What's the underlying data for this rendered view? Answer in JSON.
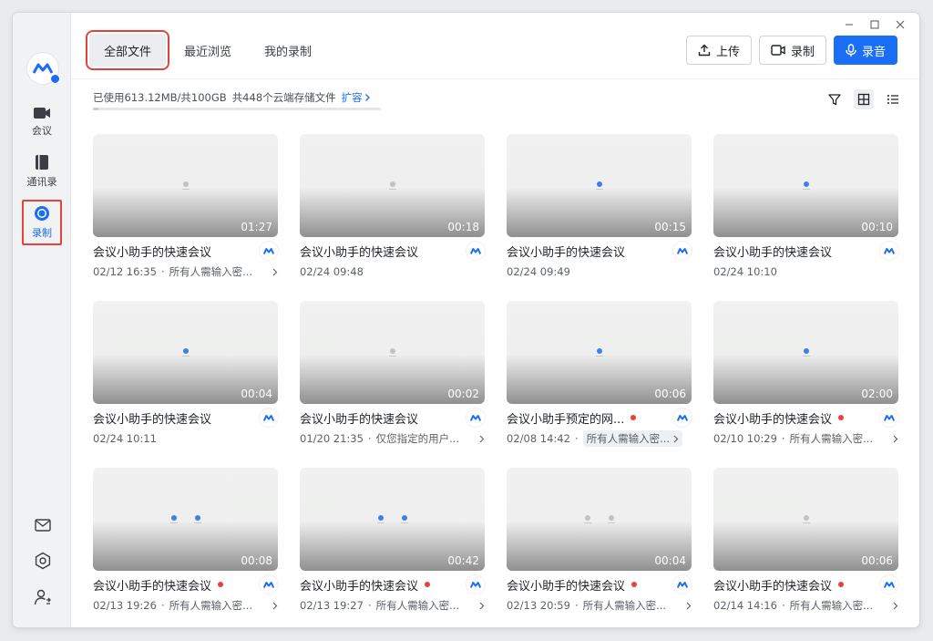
{
  "window": {
    "controls": [
      "minimize",
      "maximize",
      "close"
    ]
  },
  "sidebar": {
    "logo_text": "腾讯会议",
    "items": [
      {
        "label": "会议",
        "icon": "video-icon"
      },
      {
        "label": "通讯录",
        "icon": "contacts-icon"
      },
      {
        "label": "录制",
        "icon": "record-icon",
        "active": true
      }
    ],
    "bottom_icons": [
      "mail-icon",
      "settings-icon",
      "user-switch-icon"
    ]
  },
  "tabs": [
    {
      "label": "全部文件",
      "active": true
    },
    {
      "label": "最近浏览"
    },
    {
      "label": "我的录制"
    }
  ],
  "actions": {
    "upload": "上传",
    "record": "录制",
    "audio": "录音"
  },
  "storage": {
    "text": "已使用613.12MB/共100GB",
    "count_text": "共448个云端存储文件",
    "expand": "扩容",
    "used_fraction": 0.006
  },
  "colors": {
    "accent": "#1a6ef5",
    "highlight": "#e5433a"
  },
  "cards": [
    {
      "title": "会议小助手的快速会议",
      "duration": "01:27",
      "date": "02/12 16:35",
      "perm": "所有人需输入密...",
      "red": false,
      "chev": true,
      "thumb": [
        "grey"
      ]
    },
    {
      "title": "会议小助手的快速会议",
      "duration": "00:18",
      "date": "02/24 09:48",
      "perm": "",
      "red": false,
      "chev": false,
      "thumb": [
        "grey"
      ]
    },
    {
      "title": "会议小助手的快速会议",
      "duration": "00:15",
      "date": "02/24 09:49",
      "perm": "",
      "red": false,
      "chev": false,
      "thumb": [
        "blue"
      ]
    },
    {
      "title": "会议小助手的快速会议",
      "duration": "00:10",
      "date": "02/24 10:10",
      "perm": "",
      "red": false,
      "chev": false,
      "thumb": [
        "blue"
      ]
    },
    {
      "title": "会议小助手的快速会议",
      "duration": "00:04",
      "date": "02/24 10:11",
      "perm": "",
      "red": false,
      "chev": false,
      "thumb": [
        "blue"
      ]
    },
    {
      "title": "会议小助手的快速会议",
      "duration": "00:02",
      "date": "01/20 21:35",
      "perm": "仅您指定的用户...",
      "red": false,
      "chev": true,
      "thumb": [
        "grey"
      ]
    },
    {
      "title": "会议小助手预定的网...",
      "duration": "00:06",
      "date": "02/08 14:42",
      "perm": "所有人需输入密...",
      "red": true,
      "chev": true,
      "hl": true,
      "thumb": [
        "blue"
      ]
    },
    {
      "title": "会议小助手的快速会议",
      "duration": "02:00",
      "date": "02/10 10:29",
      "perm": "所有人需输入密...",
      "red": true,
      "chev": true,
      "thumb": [
        "blue"
      ]
    },
    {
      "title": "会议小助手的快速会议",
      "duration": "00:08",
      "date": "02/13 19:26",
      "perm": "所有人需输入密...",
      "red": true,
      "chev": true,
      "thumb": [
        "blue",
        "blue"
      ]
    },
    {
      "title": "会议小助手的快速会议",
      "duration": "00:42",
      "date": "02/13 19:27",
      "perm": "所有人需输入密...",
      "red": true,
      "chev": true,
      "thumb": [
        "blue",
        "blue"
      ]
    },
    {
      "title": "会议小助手的快速会议",
      "duration": "00:04",
      "date": "02/13 20:59",
      "perm": "所有人需输入密...",
      "red": true,
      "chev": true,
      "thumb": [
        "grey",
        "grey"
      ]
    },
    {
      "title": "会议小助手的快速会议",
      "duration": "00:06",
      "date": "02/14 14:16",
      "perm": "所有人需输入密...",
      "red": true,
      "chev": true,
      "thumb": [
        "grey"
      ]
    }
  ]
}
